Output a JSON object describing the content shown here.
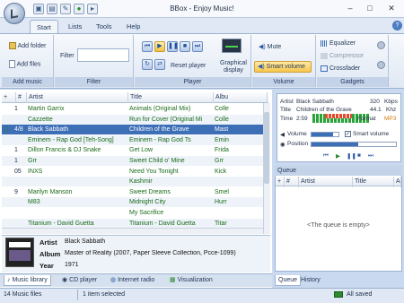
{
  "window": {
    "title": "BBox - Enjoy Music!",
    "min": "–",
    "max": "□",
    "close": "✕"
  },
  "tabs": [
    "Start",
    "Lists",
    "Tools",
    "Help"
  ],
  "ribbon": {
    "add_music": {
      "label": "Add music",
      "add_folder": "Add folder",
      "add_files": "Add files"
    },
    "filter": {
      "label": "Filter",
      "field_label": "Filter",
      "value": ""
    },
    "player": {
      "label": "Player",
      "reset": "Reset player",
      "graphical_display": "Graphical display"
    },
    "volume": {
      "label": "Volume",
      "mute": "Mute",
      "smart_volume": "Smart volume"
    },
    "gadgets": {
      "label": "Gadgets",
      "equalizer": "Equalizer",
      "compressor": "Compressor",
      "crossfader": "Crossfader"
    }
  },
  "library": {
    "columns": [
      "#",
      "Artist",
      "Title",
      "Albu"
    ],
    "rows": [
      {
        "num": "1",
        "artist": "Martin Garrix",
        "title": "Animals (Original Mix)",
        "album": "Colle"
      },
      {
        "num": "",
        "artist": "Cazzette",
        "title": "Run for Cover (Original Mi",
        "album": "Colle"
      },
      {
        "num": "4/8",
        "artist": "Black Sabbath",
        "title": "Children of the Grave",
        "album": "Mast"
      },
      {
        "num": "",
        "artist": "Eminem - Rap God [Teh-Song]",
        "title": "Eminem - Rap God Ts",
        "album": "Emin"
      },
      {
        "num": "1",
        "artist": "Dillon Francis & DJ Snake",
        "title": "Get Low",
        "album": "Frida"
      },
      {
        "num": "1",
        "artist": "Grr",
        "title": "Sweet Child o' Mine",
        "album": "Grr"
      },
      {
        "num": "05",
        "artist": "INXS",
        "title": "Need You Tonight",
        "album": "Kick"
      },
      {
        "num": "",
        "artist": "",
        "title": "Kashmir",
        "album": ""
      },
      {
        "num": "9",
        "artist": "Marilyn Manson",
        "title": "Sweet Dreams",
        "album": "Smel"
      },
      {
        "num": "",
        "artist": "M83",
        "title": "Midnight City",
        "album": "Hurr"
      },
      {
        "num": "",
        "artist": "",
        "title": "My Sacrifice",
        "album": ""
      },
      {
        "num": "",
        "artist": "Titanium - David Guetta",
        "title": "Titanium - David Guetta",
        "album": "Titar"
      }
    ]
  },
  "info": {
    "artist_label": "Artist",
    "artist": "Black Sabbath",
    "album_label": "Album",
    "album": "Master of Reality (2007, Paper Sleeve Collection, Pcce-1099)",
    "year_label": "Year",
    "year": "1971"
  },
  "bottom_tabs": [
    "Music library",
    "CD player",
    "Internet radio",
    "Visualization"
  ],
  "status": {
    "files": "14 Music files",
    "selected": "1 item selected",
    "saved": "All saved"
  },
  "now_playing": {
    "artist_label": "Artist",
    "artist": "Black Sabbath",
    "bitrate": "320",
    "bitrate_unit": "Kbps",
    "title_label": "Title",
    "title": "Children of the Grave",
    "samplerate": "44.1",
    "samplerate_unit": "Khz",
    "time_label": "Time",
    "time": "2:59",
    "format_label": "Format",
    "format": "MP3",
    "volume_label": "Volume",
    "smart_volume_label": "Smart volume",
    "position_label": "Position",
    "volume_level": 0.8,
    "position_level": 0.55
  },
  "queue": {
    "title": "Queue",
    "columns": [
      "#",
      "Artist",
      "Title",
      "A"
    ],
    "empty": "<The queue is empty>",
    "tabs": [
      "Queue",
      "History"
    ]
  },
  "colors": {
    "accent": "#3d6fb7",
    "ribbon": "#dfe8f4",
    "smart_volume": "#f6c64c"
  }
}
